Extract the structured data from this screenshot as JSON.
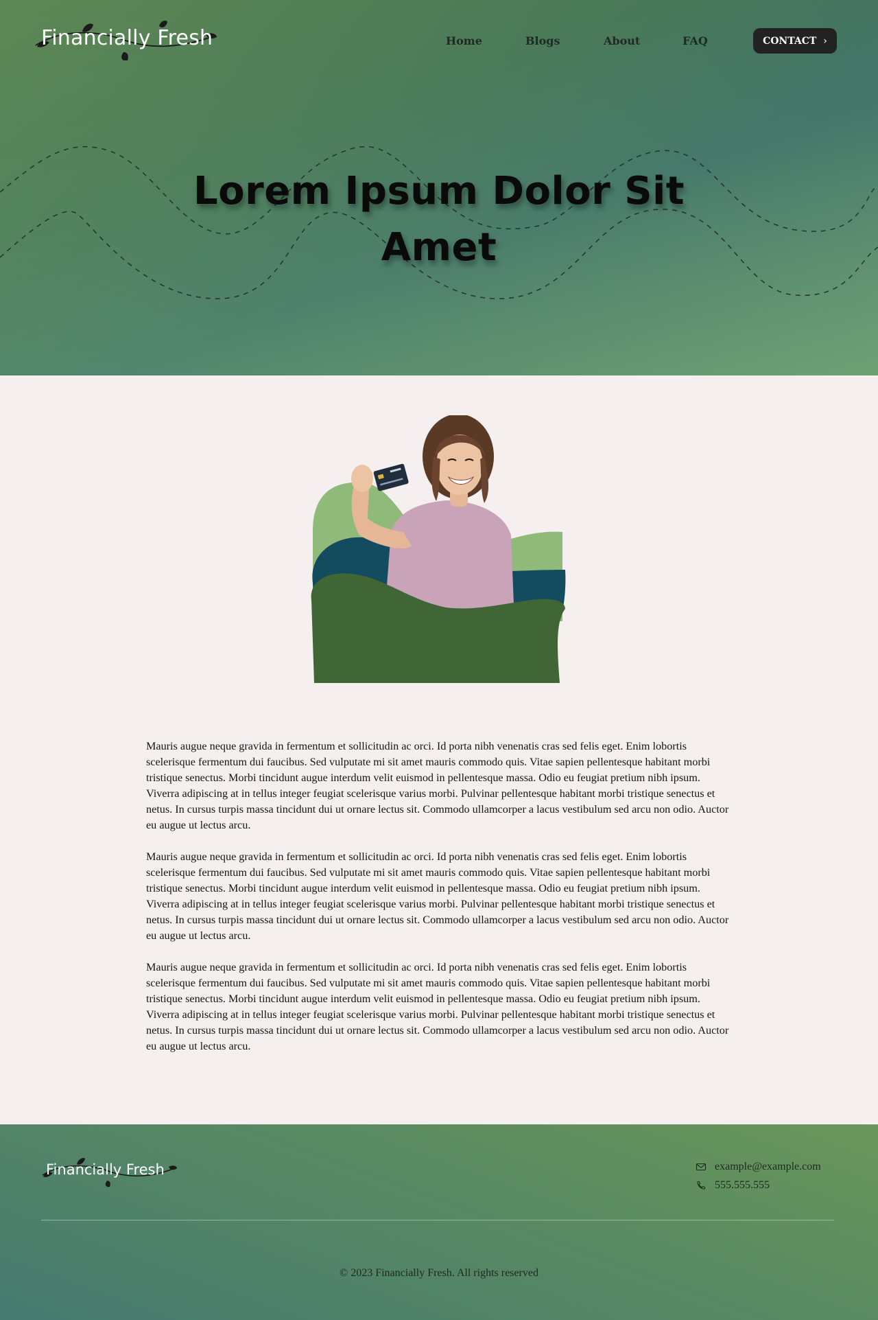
{
  "brand": {
    "name": "Financially Fresh"
  },
  "nav": {
    "items": [
      {
        "label": "Home"
      },
      {
        "label": "Blogs"
      },
      {
        "label": "About"
      },
      {
        "label": "FAQ"
      }
    ],
    "cta_label": "CONTACT"
  },
  "hero": {
    "title_line1": "Lorem Ipsum Dolor Sit",
    "title_line2": "Amet"
  },
  "article": {
    "paragraphs": [
      "Mauris augue neque gravida in fermentum et sollicitudin ac orci. Id porta nibh venenatis cras sed felis eget. Enim lobortis scelerisque fermentum dui faucibus. Sed vulputate mi sit amet mauris commodo quis. Vitae sapien pellentesque habitant morbi tristique senectus. Morbi tincidunt augue interdum velit euismod in pellentesque massa. Odio eu feugiat pretium nibh ipsum. Viverra adipiscing at in tellus integer feugiat scelerisque varius morbi. Pulvinar pellentesque habitant morbi tristique senectus et netus. In cursus turpis massa tincidunt dui ut ornare lectus sit. Commodo ullamcorper a lacus vestibulum sed arcu non odio. Auctor eu augue ut lectus arcu.",
      "Mauris augue neque gravida in fermentum et sollicitudin ac orci. Id porta nibh venenatis cras sed felis eget. Enim lobortis scelerisque fermentum dui faucibus. Sed vulputate mi sit amet mauris commodo quis. Vitae sapien pellentesque habitant morbi tristique senectus. Morbi tincidunt augue interdum velit euismod in pellentesque massa. Odio eu feugiat pretium nibh ipsum. Viverra adipiscing at in tellus integer feugiat scelerisque varius morbi. Pulvinar pellentesque habitant morbi tristique senectus et netus. In cursus turpis massa tincidunt dui ut ornare lectus sit. Commodo ullamcorper a lacus vestibulum sed arcu non odio. Auctor eu augue ut lectus arcu.",
      "Mauris augue neque gravida in fermentum et sollicitudin ac orci. Id porta nibh venenatis cras sed felis eget. Enim lobortis scelerisque fermentum dui faucibus. Sed vulputate mi sit amet mauris commodo quis. Vitae sapien pellentesque habitant morbi tristique senectus. Morbi tincidunt augue interdum velit euismod in pellentesque massa. Odio eu feugiat pretium nibh ipsum. Viverra adipiscing at in tellus integer feugiat scelerisque varius morbi. Pulvinar pellentesque habitant morbi tristique senectus et netus. In cursus turpis massa tincidunt dui ut ornare lectus sit. Commodo ullamcorper a lacus vestibulum sed arcu non odio. Auctor eu augue ut lectus arcu."
    ]
  },
  "footer": {
    "brand_name": "Financially Fresh",
    "email": "example@example.com",
    "phone": "555.555.555",
    "email_icon": "mail-icon",
    "phone_icon": "phone-icon",
    "copyright": "© 2023 Financially Fresh. All rights reserved"
  },
  "colors": {
    "hero_green": "#5f8a55",
    "hero_teal": "#3f726c",
    "page_background": "#f5efef",
    "button_dark": "#222222",
    "shape_light_green": "#8fba7a",
    "shape_navy": "#134b5f",
    "shape_dark_green": "#416635"
  }
}
